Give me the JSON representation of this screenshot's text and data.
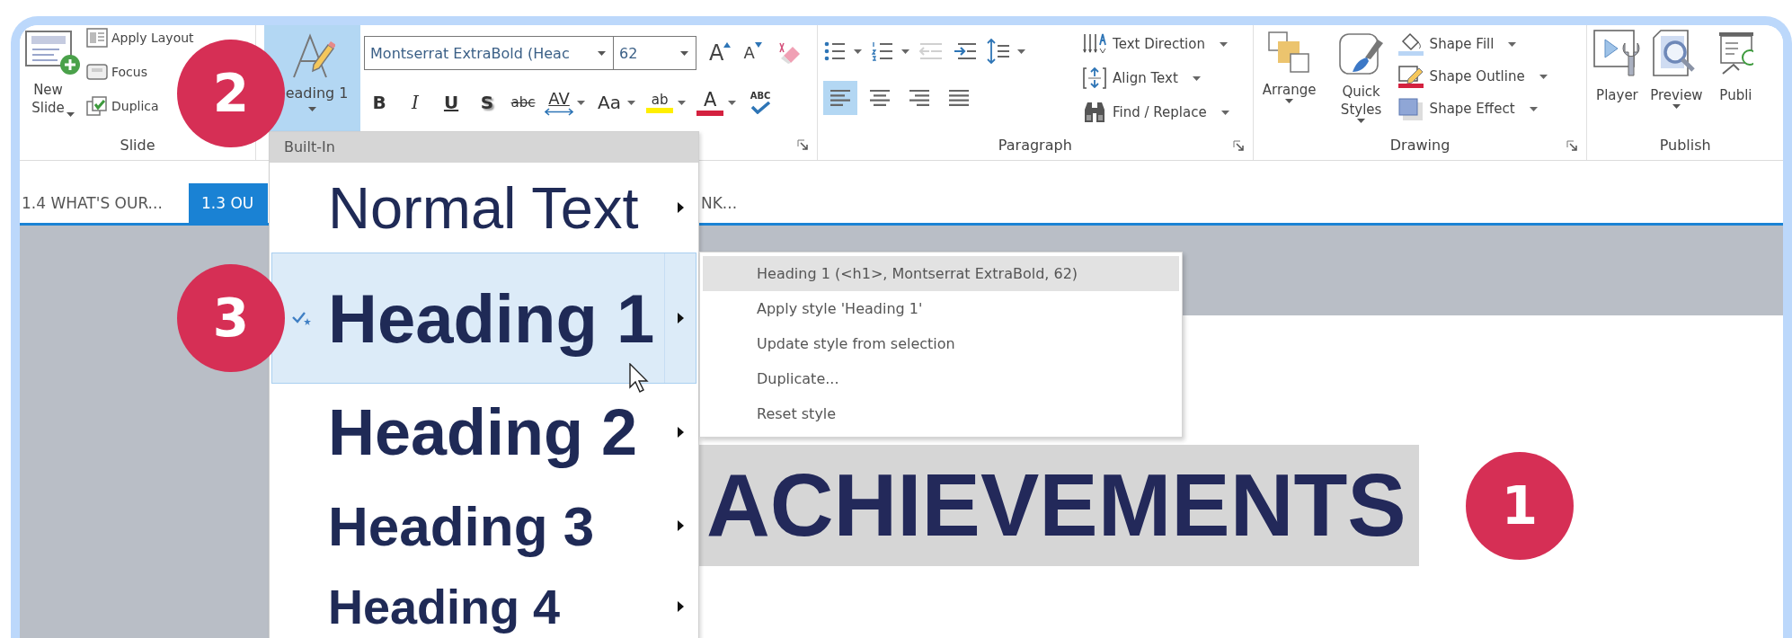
{
  "ribbon": {
    "slide_group": {
      "label": "Slide",
      "new_slide": "New\nSlide",
      "commands": [
        {
          "kind": "layout",
          "label": "Apply Layout"
        },
        {
          "kind": "focus",
          "label": "Focus"
        },
        {
          "kind": "duplicate",
          "label": "Duplica"
        }
      ]
    },
    "style_button": {
      "label": "eading 1",
      "selected": true
    },
    "font": {
      "name": "Montserrat ExtraBold (Heac",
      "size": "62",
      "size_tools": [
        {
          "kind": "grow",
          "text": "A"
        },
        {
          "kind": "shrink",
          "text": "A"
        }
      ],
      "format": [
        {
          "kind": "bold",
          "text": "B"
        },
        {
          "kind": "italic",
          "text": "I"
        },
        {
          "kind": "underline",
          "text": "U"
        },
        {
          "kind": "shadow",
          "text": "S"
        },
        {
          "kind": "strike",
          "text": "abc"
        },
        {
          "kind": "spacing",
          "text": "AV"
        },
        {
          "kind": "case",
          "text": "Aa"
        },
        {
          "kind": "highlight",
          "text": "ab"
        },
        {
          "kind": "color",
          "text": "A"
        },
        {
          "kind": "spell",
          "text": "ABC"
        }
      ]
    },
    "paragraph": {
      "label": "Paragraph",
      "lists": [
        {
          "kind": "bullets",
          "disabled": false
        },
        {
          "kind": "numbering",
          "disabled": false
        },
        {
          "kind": "outdent",
          "disabled": true
        },
        {
          "kind": "indent",
          "disabled": false
        },
        {
          "kind": "spacing",
          "disabled": false
        }
      ],
      "align": [
        {
          "kind": "left",
          "selected": true
        },
        {
          "kind": "center",
          "selected": false
        },
        {
          "kind": "right",
          "selected": false
        },
        {
          "kind": "justify",
          "selected": false
        }
      ],
      "commands": [
        {
          "kind": "direction",
          "label": "Text Direction"
        },
        {
          "kind": "align",
          "label": "Align Text"
        },
        {
          "kind": "find",
          "label": "Find / Replace"
        }
      ]
    },
    "drawing": {
      "label": "Drawing",
      "buttons": [
        {
          "kind": "arrange",
          "label": "Arrange"
        },
        {
          "kind": "styles",
          "label": "Quick\nStyles"
        }
      ],
      "shape_tools": [
        {
          "kind": "fill",
          "label": "Shape Fill"
        },
        {
          "kind": "outline",
          "label": "Shape Outline"
        },
        {
          "kind": "effect",
          "label": "Shape Effect"
        }
      ]
    },
    "publish": {
      "label": "Publish",
      "buttons": [
        {
          "kind": "player",
          "label": "Player"
        },
        {
          "kind": "preview",
          "label": "Preview"
        },
        {
          "kind": "publish",
          "label": "Publi"
        }
      ]
    }
  },
  "tabs": [
    {
      "label": "1.4 WHAT'S OUR...",
      "selected": false
    },
    {
      "label": "1.3 OU",
      "selected": true
    },
    {
      "label": "NK...",
      "selected": false
    }
  ],
  "slide": {
    "title": "ACHIEVEMENTS"
  },
  "styles_menu": {
    "header": "Built-In",
    "items": [
      {
        "kind": "normal",
        "label": "Normal Text",
        "selected": false
      },
      {
        "kind": "h1",
        "label": "Heading 1",
        "selected": true
      },
      {
        "kind": "h2",
        "label": "Heading 2",
        "selected": false
      },
      {
        "kind": "h3",
        "label": "Heading 3",
        "selected": false
      },
      {
        "kind": "h4",
        "label": "Heading 4",
        "selected": false
      }
    ]
  },
  "style_submenu": {
    "items": [
      {
        "label": "Heading 1 (<h1>, Montserrat ExtraBold, 62)",
        "selected": true
      },
      {
        "label": "Apply style 'Heading 1'",
        "selected": false
      },
      {
        "label": "Update style from selection",
        "selected": false
      },
      {
        "label": "Duplicate...",
        "selected": false
      },
      {
        "label": "Reset style",
        "selected": false
      }
    ]
  },
  "callouts": [
    {
      "text": "1"
    },
    {
      "text": "2"
    },
    {
      "text": "3"
    }
  ]
}
